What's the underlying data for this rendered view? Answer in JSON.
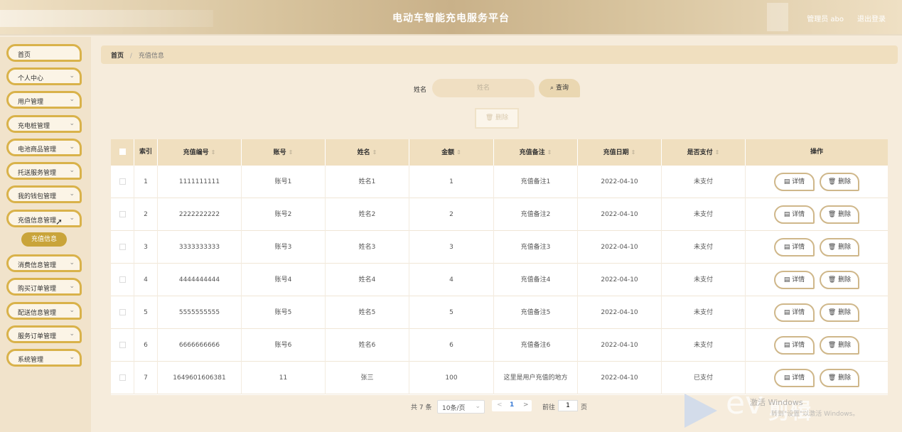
{
  "header": {
    "title": "电动车智能充电服务平台",
    "admin": "管理员 abo",
    "logout": "退出登录"
  },
  "sidebar": {
    "items": [
      {
        "label": "首页",
        "chev": ""
      },
      {
        "label": "个人中心",
        "chev": "⌄"
      },
      {
        "label": "用户管理",
        "chev": "⌄"
      },
      {
        "label": "充电桩管理",
        "chev": "⌄"
      },
      {
        "label": "电池商品管理",
        "chev": "⌄"
      },
      {
        "label": "托送服务管理",
        "chev": "⌄"
      },
      {
        "label": "我的钱包管理",
        "chev": "⌄"
      },
      {
        "label": "充值信息管理",
        "chev": "⌄"
      },
      {
        "label": "消费信息管理",
        "chev": "⌄"
      },
      {
        "label": "购买订单管理",
        "chev": "⌄"
      },
      {
        "label": "配送信息管理",
        "chev": "⌄"
      },
      {
        "label": "服务订单管理",
        "chev": "⌄"
      },
      {
        "label": "系统管理",
        "chev": "⌄"
      }
    ],
    "active_sub": "充值信息"
  },
  "breadcrumb": {
    "home": "首页",
    "sep": "/",
    "current": "充值信息"
  },
  "search": {
    "label": "姓名",
    "placeholder": "姓名",
    "button": "⌕ 查询"
  },
  "delete_top": "🗑 删除",
  "table": {
    "headers": {
      "index": "索引",
      "code": "充值编号",
      "account": "账号",
      "name": "姓名",
      "amount": "金额",
      "note": "充值备注",
      "date": "充值日期",
      "paid": "是否支付",
      "ops": "操作",
      "sort": "⇕"
    },
    "rows": [
      {
        "index": "1",
        "code": "1111111111",
        "account": "账号1",
        "name": "姓名1",
        "amount": "1",
        "note": "充值备注1",
        "date": "2022-04-10",
        "paid": "未支付"
      },
      {
        "index": "2",
        "code": "2222222222",
        "account": "账号2",
        "name": "姓名2",
        "amount": "2",
        "note": "充值备注2",
        "date": "2022-04-10",
        "paid": "未支付"
      },
      {
        "index": "3",
        "code": "3333333333",
        "account": "账号3",
        "name": "姓名3",
        "amount": "3",
        "note": "充值备注3",
        "date": "2022-04-10",
        "paid": "未支付"
      },
      {
        "index": "4",
        "code": "4444444444",
        "account": "账号4",
        "name": "姓名4",
        "amount": "4",
        "note": "充值备注4",
        "date": "2022-04-10",
        "paid": "未支付"
      },
      {
        "index": "5",
        "code": "5555555555",
        "account": "账号5",
        "name": "姓名5",
        "amount": "5",
        "note": "充值备注5",
        "date": "2022-04-10",
        "paid": "未支付"
      },
      {
        "index": "6",
        "code": "6666666666",
        "account": "账号6",
        "name": "姓名6",
        "amount": "6",
        "note": "充值备注6",
        "date": "2022-04-10",
        "paid": "未支付"
      },
      {
        "index": "7",
        "code": "1649601606381",
        "account": "11",
        "name": "张三",
        "amount": "100",
        "note": "这里是用户充值的地方",
        "date": "2022-04-10",
        "paid": "已支付"
      }
    ],
    "detail_label": "▤ 详情",
    "delete_label": "🗑 删除"
  },
  "pagination": {
    "total": "共 7 条",
    "page_size": "10条/页",
    "page_size_arrow": "⌄",
    "prev": "<",
    "current": "1",
    "next": ">",
    "goto": "前往",
    "goto_value": "1",
    "suffix": "页"
  },
  "watermark": {
    "brand": "ev",
    "cn": "剪辑",
    "activate": "激活 Windows",
    "activate_sub": "转到\"设置\"以激活 Windows。"
  },
  "colors": {
    "accent": "#d9b24a",
    "header": "#c9b189",
    "link": "#3a7bd5"
  }
}
